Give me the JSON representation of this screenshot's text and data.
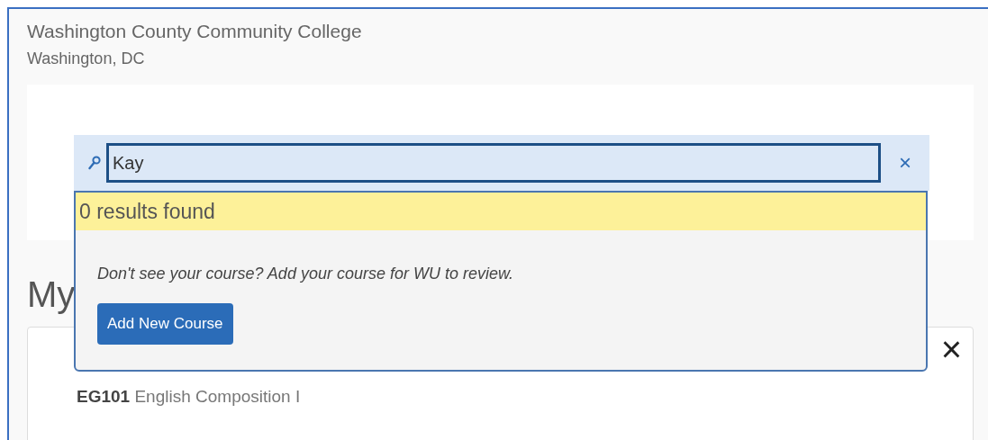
{
  "header": {
    "title": "Washington County Community College",
    "location": "Washington, DC"
  },
  "search": {
    "value": "Kay",
    "clear": "×"
  },
  "results": {
    "summary": "0 results found",
    "hint": "Don't see your course? Add your course for WU to review.",
    "button": "Add New Course"
  },
  "section": {
    "heading": "My"
  },
  "card": {
    "close": "×",
    "course_code": "EG101",
    "course_name": "English Composition I"
  }
}
